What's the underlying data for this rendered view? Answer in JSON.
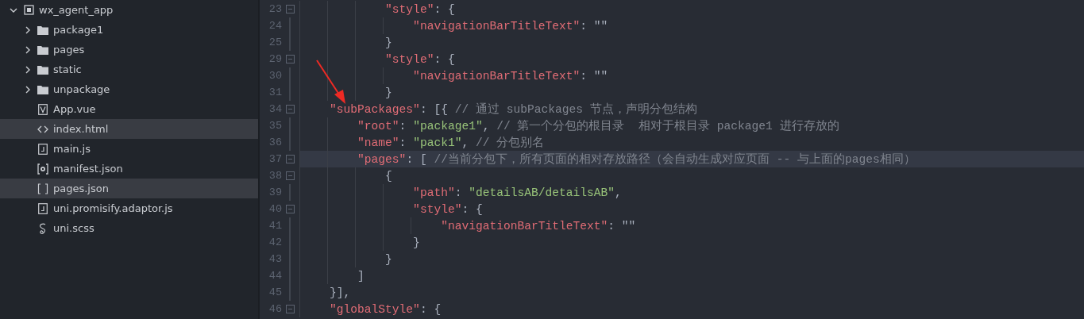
{
  "explorer": {
    "tree": [
      {
        "label": "wx_agent_app",
        "kind": "project",
        "expanded": true,
        "selected": false,
        "children": [
          {
            "label": "package1",
            "kind": "folder",
            "expanded": false,
            "selected": false
          },
          {
            "label": "pages",
            "kind": "folder",
            "expanded": false,
            "selected": false
          },
          {
            "label": "static",
            "kind": "folder",
            "expanded": false,
            "selected": false
          },
          {
            "label": "unpackage",
            "kind": "folder",
            "expanded": false,
            "selected": false
          },
          {
            "label": "App.vue",
            "kind": "vue",
            "selected": false
          },
          {
            "label": "index.html",
            "kind": "html",
            "selected": true
          },
          {
            "label": "main.js",
            "kind": "js",
            "selected": false
          },
          {
            "label": "manifest.json",
            "kind": "config",
            "selected": false
          },
          {
            "label": "pages.json",
            "kind": "json",
            "selected": true
          },
          {
            "label": "uni.promisify.adaptor.js",
            "kind": "js",
            "selected": false
          },
          {
            "label": "uni.scss",
            "kind": "scss",
            "selected": false
          }
        ]
      }
    ]
  },
  "editor": {
    "lines": [
      {
        "number": "23",
        "foldable": true,
        "current": false,
        "tokens": [
          {
            "kind": "key",
            "text": "            \"style\""
          },
          {
            "kind": "punct",
            "text": ": {"
          }
        ]
      },
      {
        "number": "24",
        "foldable": false,
        "current": false,
        "tokens": [
          {
            "kind": "key",
            "text": "                \"navigationBarTitleText\""
          },
          {
            "kind": "punct",
            "text": ": \"\""
          }
        ]
      },
      {
        "number": "25",
        "foldable": false,
        "current": false,
        "tokens": [
          {
            "kind": "punct",
            "text": "            }"
          }
        ]
      },
      {
        "number": "29",
        "foldable": true,
        "current": false,
        "tokens": [
          {
            "kind": "key",
            "text": "            \"style\""
          },
          {
            "kind": "punct",
            "text": ": {"
          }
        ]
      },
      {
        "number": "30",
        "foldable": false,
        "current": false,
        "tokens": [
          {
            "kind": "key",
            "text": "                \"navigationBarTitleText\""
          },
          {
            "kind": "punct",
            "text": ": \"\""
          }
        ]
      },
      {
        "number": "31",
        "foldable": false,
        "current": false,
        "tokens": [
          {
            "kind": "punct",
            "text": "            }"
          }
        ]
      },
      {
        "number": "34",
        "foldable": true,
        "current": false,
        "tokens": [
          {
            "kind": "key",
            "text": "    \"subPackages\""
          },
          {
            "kind": "punct",
            "text": ": [{ "
          },
          {
            "kind": "comment",
            "text": "// 通过 subPackages 节点，声明分包结构"
          }
        ]
      },
      {
        "number": "35",
        "foldable": false,
        "current": false,
        "tokens": [
          {
            "kind": "key",
            "text": "        \"root\""
          },
          {
            "kind": "punct",
            "text": ": "
          },
          {
            "kind": "string",
            "text": "\"package1\""
          },
          {
            "kind": "punct",
            "text": ", "
          },
          {
            "kind": "comment",
            "text": "// 第一个分包的根目录  相对于根目录 package1 进行存放的"
          }
        ]
      },
      {
        "number": "36",
        "foldable": false,
        "current": false,
        "tokens": [
          {
            "kind": "key",
            "text": "        \"name\""
          },
          {
            "kind": "punct",
            "text": ": "
          },
          {
            "kind": "string",
            "text": "\"pack1\""
          },
          {
            "kind": "punct",
            "text": ", "
          },
          {
            "kind": "comment",
            "text": "// 分包别名"
          }
        ]
      },
      {
        "number": "37",
        "foldable": true,
        "current": true,
        "tokens": [
          {
            "kind": "key",
            "text": "        \"pages\""
          },
          {
            "kind": "punct",
            "text": ": [ "
          },
          {
            "kind": "comment",
            "text": "//当前分包下，所有页面的相对存放路径（会自动生成对应页面 -- 与上面的pages相同）"
          }
        ]
      },
      {
        "number": "38",
        "foldable": true,
        "current": false,
        "tokens": [
          {
            "kind": "punct",
            "text": "            {"
          }
        ]
      },
      {
        "number": "39",
        "foldable": false,
        "current": false,
        "tokens": [
          {
            "kind": "key",
            "text": "                \"path\""
          },
          {
            "kind": "punct",
            "text": ": "
          },
          {
            "kind": "string",
            "text": "\"detailsAB/detailsAB\""
          },
          {
            "kind": "punct",
            "text": ","
          }
        ]
      },
      {
        "number": "40",
        "foldable": true,
        "current": false,
        "tokens": [
          {
            "kind": "key",
            "text": "                \"style\""
          },
          {
            "kind": "punct",
            "text": ": {"
          }
        ]
      },
      {
        "number": "41",
        "foldable": false,
        "current": false,
        "tokens": [
          {
            "kind": "key",
            "text": "                    \"navigationBarTitleText\""
          },
          {
            "kind": "punct",
            "text": ": \"\""
          }
        ]
      },
      {
        "number": "42",
        "foldable": false,
        "current": false,
        "tokens": [
          {
            "kind": "punct",
            "text": "                }"
          }
        ]
      },
      {
        "number": "43",
        "foldable": false,
        "current": false,
        "tokens": [
          {
            "kind": "punct",
            "text": "            }"
          }
        ]
      },
      {
        "number": "44",
        "foldable": false,
        "current": false,
        "tokens": [
          {
            "kind": "punct",
            "text": "        ]"
          }
        ]
      },
      {
        "number": "45",
        "foldable": false,
        "current": false,
        "tokens": [
          {
            "kind": "punct",
            "text": "    }],"
          }
        ]
      },
      {
        "number": "46",
        "foldable": true,
        "current": false,
        "tokens": [
          {
            "kind": "key",
            "text": "    \"globalStyle\""
          },
          {
            "kind": "punct",
            "text": ": {"
          }
        ]
      }
    ]
  }
}
